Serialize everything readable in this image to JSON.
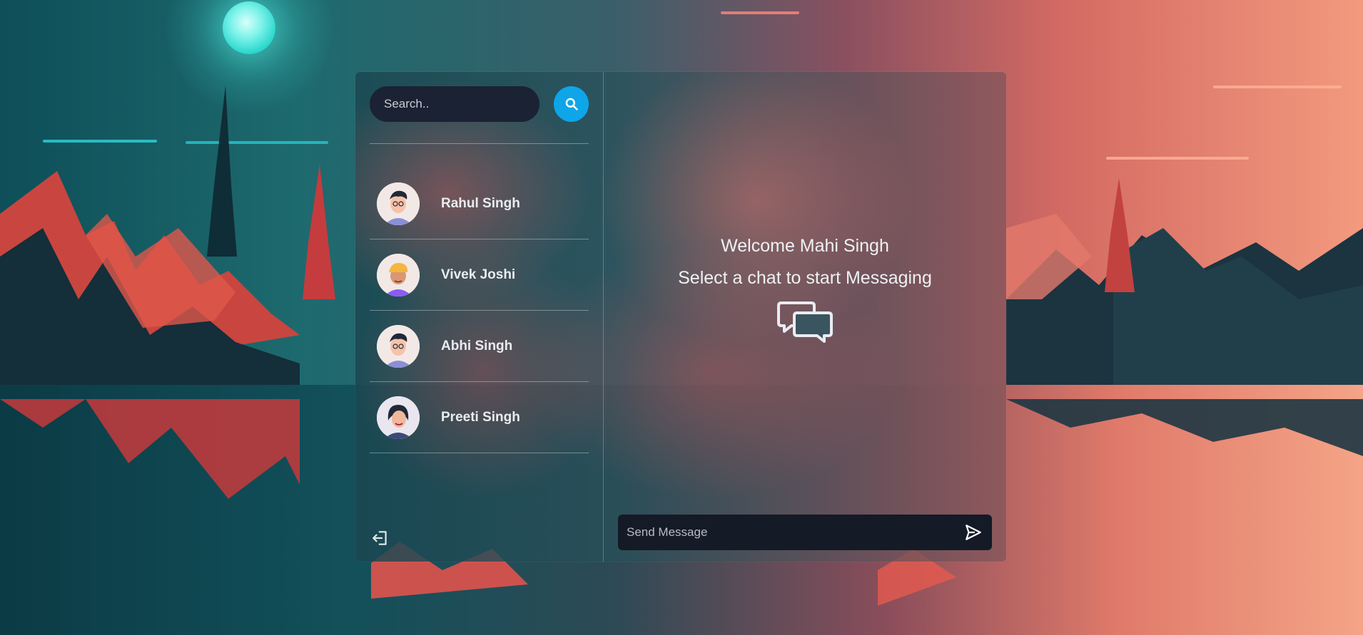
{
  "sidebar": {
    "search": {
      "placeholder": "Search.."
    },
    "conversations": [
      {
        "name": "Rahul Singh",
        "avatar": "male-avatar-glasses"
      },
      {
        "name": "Vivek Joshi",
        "avatar": "male-avatar-yellow-cap"
      },
      {
        "name": "Abhi Singh",
        "avatar": "male-avatar-glasses"
      },
      {
        "name": "Preeti Singh",
        "avatar": "female-avatar"
      }
    ],
    "logout_icon": "logout-icon"
  },
  "main": {
    "welcome_line": "Welcome Mahi Singh",
    "instruction_line": "Select a chat to start Messaging",
    "empty_state_icon": "chat-bubbles-icon",
    "composer": {
      "placeholder": "Send Message",
      "send_icon": "send-icon"
    }
  },
  "colors": {
    "accent": "#0ea5e9",
    "input_bg": "#1b2233",
    "text": "#e8ecf1"
  }
}
